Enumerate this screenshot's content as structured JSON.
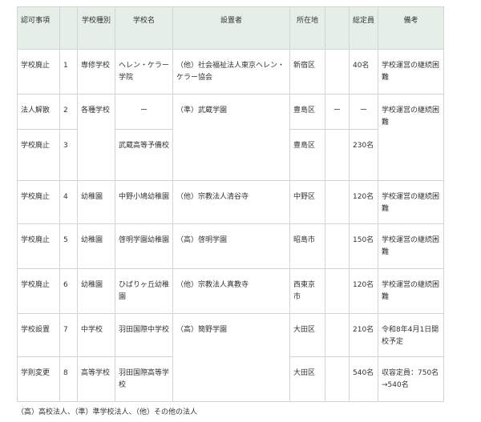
{
  "table": {
    "headers": [
      "認可事項",
      "",
      "学校種別",
      "学校名",
      "設置者",
      "所在地",
      "",
      "総定員",
      "備考"
    ],
    "rows": [
      [
        "学校廃止",
        "1",
        "専修学校",
        "ヘレン・ケラー学院",
        "（他）社会福祉法人東京ヘレン・ケラー協会",
        "新宿区",
        "",
        "40名",
        "学校運営の継続困難"
      ],
      [
        "法人解散",
        "2",
        "各種学校",
        "ー",
        "（準）武蔵学園",
        "豊島区",
        "ー",
        "ー",
        "学校運営の継続困難"
      ],
      [
        "学校廃止",
        "3",
        "",
        "武蔵高等予備校",
        "",
        "豊島区",
        "",
        "230名",
        ""
      ],
      [
        "学校廃止",
        "4",
        "幼稚園",
        "中野小鳩幼稚園",
        "（他）宗教法人清谷寺",
        "中野区",
        "",
        "120名",
        "学校運営の継続困難"
      ],
      [
        "学校廃止",
        "5",
        "幼稚園",
        "啓明学園幼稚園",
        "（高）啓明学園",
        "昭島市",
        "",
        "150名",
        "学校運営の継続困難"
      ],
      [
        "学校廃止",
        "6",
        "幼稚園",
        "ひばりヶ丘幼稚園",
        "（他）宗教法人真教寺",
        "西東京市",
        "",
        "120名",
        "学校運営の継続困難"
      ],
      [
        "学校設置",
        "7",
        "中学校",
        "羽田国際中学校",
        "（高）簡野学園",
        "大田区",
        "",
        "210名",
        "令和8年4月1日開校予定"
      ],
      [
        "学則変更",
        "8",
        "高等学校",
        "羽田国際高等学校",
        "",
        "大田区",
        "",
        "540名",
        "収容定員：750名→540名"
      ]
    ]
  },
  "footnote": "（高）高校法人、（準）準学校法人、（他）その他の法人"
}
